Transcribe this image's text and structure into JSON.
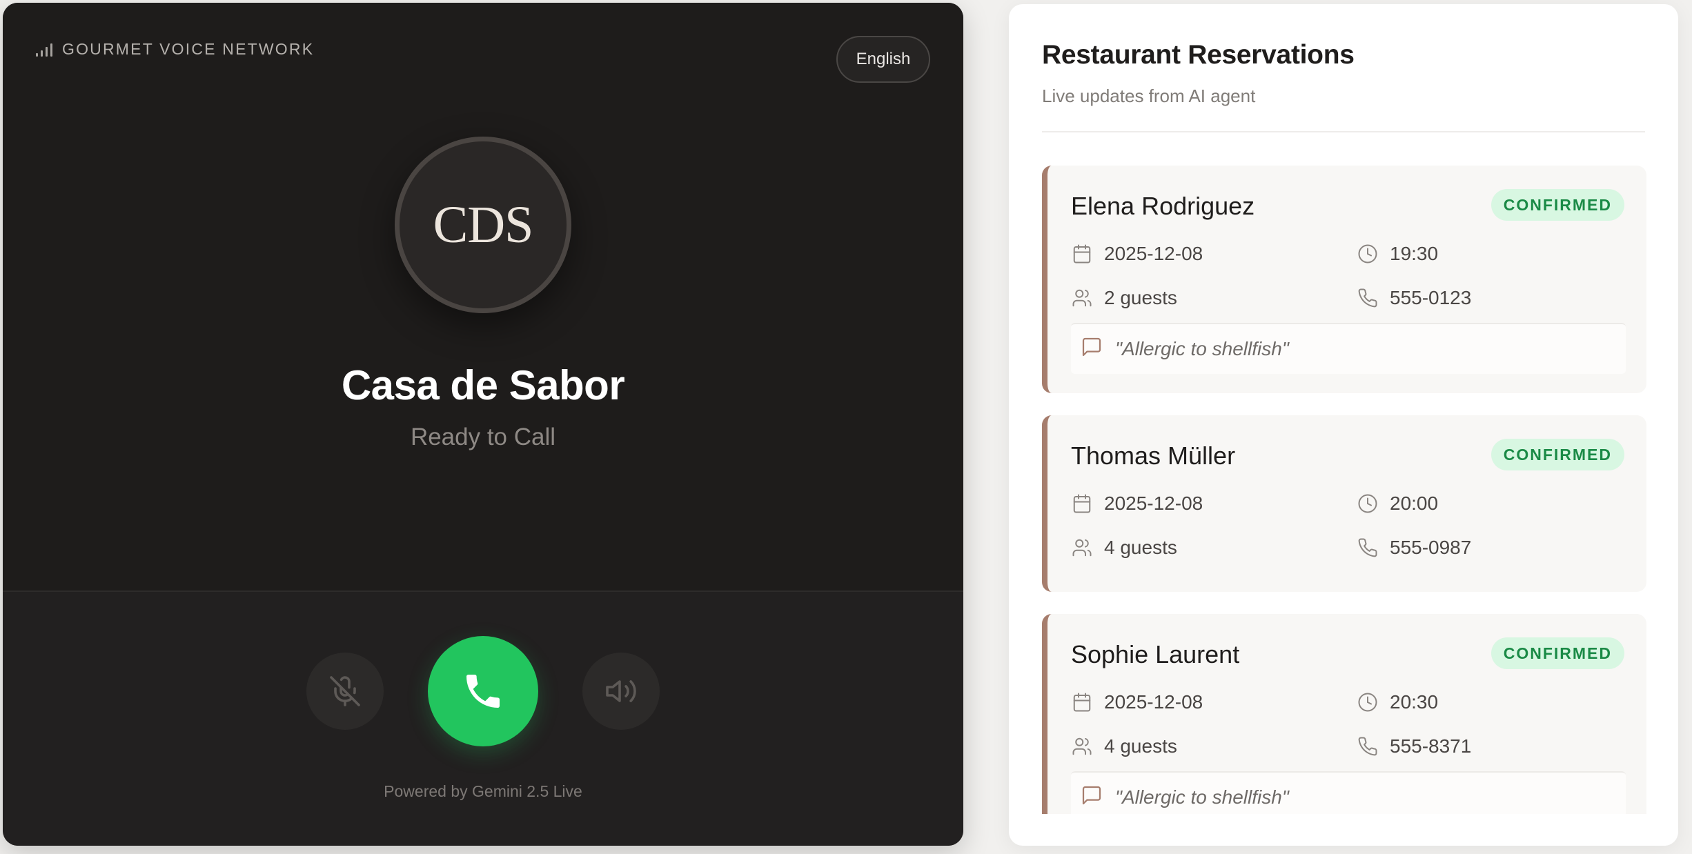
{
  "phone": {
    "brand": "GOURMET VOICE NETWORK",
    "language": "English",
    "avatar_initials": "CDS",
    "restaurant_name": "Casa de Sabor",
    "call_status": "Ready to Call",
    "powered_by": "Powered by Gemini 2.5 Live",
    "icons": {
      "mute": "mic-off-icon",
      "call": "phone-icon",
      "speaker": "speaker-icon",
      "signal": "signal-bars-icon"
    },
    "colors": {
      "call_button": "#22c55e",
      "background": "#1e1c1b"
    }
  },
  "reservations": {
    "title": "Restaurant Reservations",
    "subtitle": "Live updates from AI agent",
    "accent_color": "#a67d6d",
    "items": [
      {
        "name": "Elena Rodriguez",
        "status": "CONFIRMED",
        "date": "2025-12-08",
        "time": "19:30",
        "guests": "2 guests",
        "phone": "555-0123",
        "note": "\"Allergic to shellfish\""
      },
      {
        "name": "Thomas Müller",
        "status": "CONFIRMED",
        "date": "2025-12-08",
        "time": "20:00",
        "guests": "4 guests",
        "phone": "555-0987"
      },
      {
        "name": "Sophie Laurent",
        "status": "CONFIRMED",
        "date": "2025-12-08",
        "time": "20:30",
        "guests": "4 guests",
        "phone": "555-8371",
        "note": "\"Allergic to shellfish\""
      }
    ]
  }
}
